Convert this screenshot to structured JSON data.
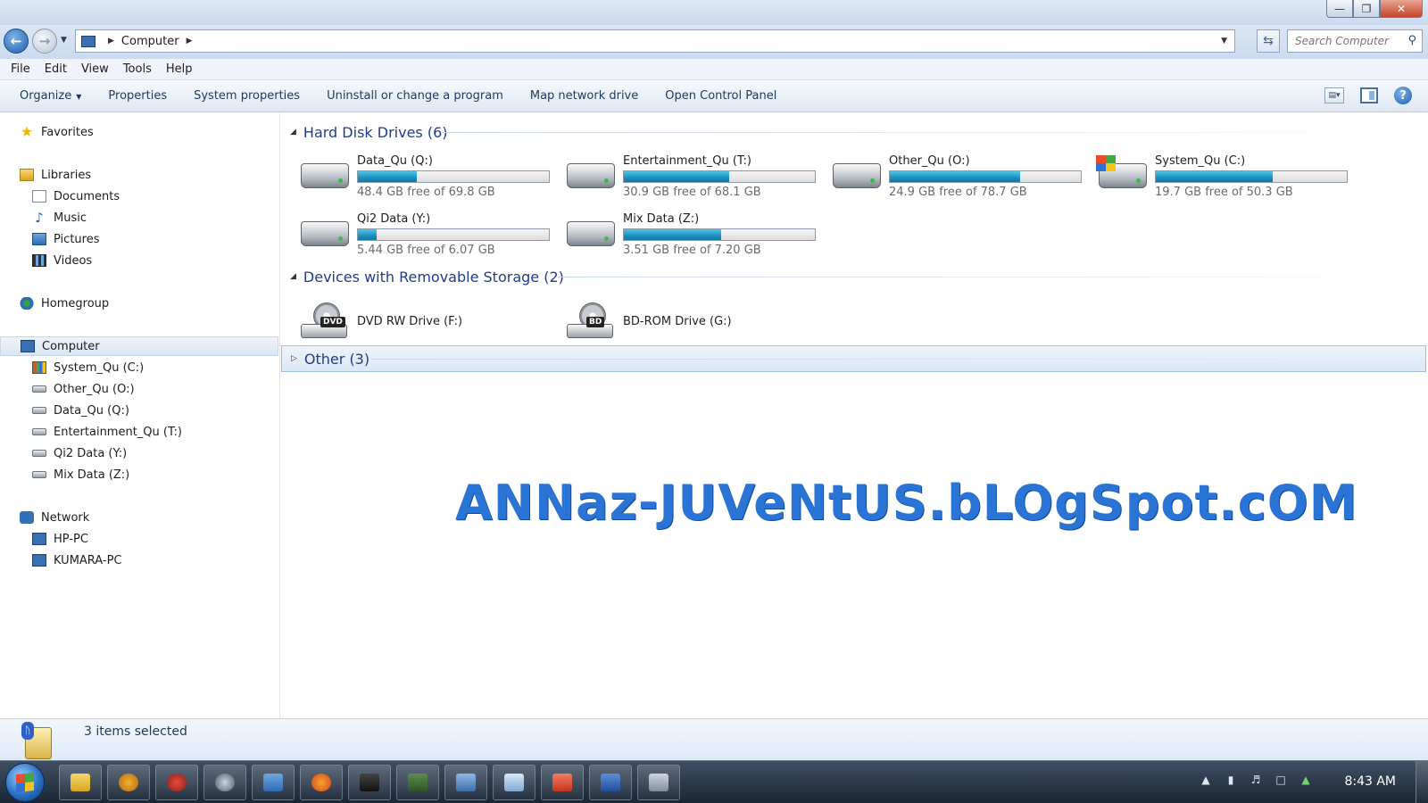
{
  "window": {
    "controls": {
      "minimize": "—",
      "maximize": "❐",
      "close": "✕"
    }
  },
  "address_bar": {
    "breadcrumb": "Computer",
    "search_placeholder": "Search Computer"
  },
  "menu": [
    "File",
    "Edit",
    "View",
    "Tools",
    "Help"
  ],
  "commands": {
    "organize": "Organize",
    "properties": "Properties",
    "system_properties": "System properties",
    "uninstall": "Uninstall or change a program",
    "map_drive": "Map network drive",
    "control_panel": "Open Control Panel"
  },
  "nav": {
    "favorites": "Favorites",
    "libraries": "Libraries",
    "documents": "Documents",
    "music": "Music",
    "pictures": "Pictures",
    "videos": "Videos",
    "homegroup": "Homegroup",
    "computer": "Computer",
    "drives": [
      "System_Qu (C:)",
      "Other_Qu (O:)",
      "Data_Qu (Q:)",
      "Entertainment_Qu (T:)",
      "Qi2 Data (Y:)",
      "Mix Data (Z:)"
    ],
    "network": "Network",
    "network_pcs": [
      "HP-PC",
      "KUMARA-PC"
    ]
  },
  "groups": {
    "hard_disks": "Hard Disk Drives (6)",
    "removable": "Devices with Removable Storage (2)",
    "other": "Other (3)"
  },
  "hard_drives": [
    {
      "name": "Data_Qu (Q:)",
      "free_text": "48.4 GB free of 69.8 GB",
      "used_fraction": 0.31
    },
    {
      "name": "Entertainment_Qu (T:)",
      "free_text": "30.9 GB free of 68.1 GB",
      "used_fraction": 0.55
    },
    {
      "name": "Other_Qu (O:)",
      "free_text": "24.9 GB free of 78.7 GB",
      "used_fraction": 0.68
    },
    {
      "name": "System_Qu (C:)",
      "free_text": "19.7 GB free of 50.3 GB",
      "used_fraction": 0.61
    },
    {
      "name": "Qi2 Data (Y:)",
      "free_text": "5.44 GB free of 6.07 GB",
      "used_fraction": 0.1
    },
    {
      "name": "Mix Data (Z:)",
      "free_text": "3.51 GB free of 7.20 GB",
      "used_fraction": 0.51
    }
  ],
  "removable_drives": [
    {
      "name": "DVD RW Drive (F:)",
      "badge": "DVD"
    },
    {
      "name": "BD-ROM Drive (G:)",
      "badge": "BD"
    }
  ],
  "watermark": "ANNaz-JUVeNtUS.bLOgSpot.cOM",
  "details": {
    "status": "3 items selected"
  },
  "taskbar": {
    "clock": "8:43 AM"
  },
  "colors": {
    "accent_blue": "#1e3d8f",
    "progress_fill": "#1d8fc0",
    "watermark": "#2a74d6"
  }
}
